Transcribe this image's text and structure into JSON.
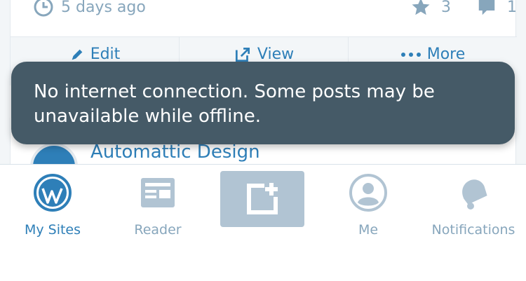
{
  "post": {
    "time_ago": "5 days ago",
    "likes": "3",
    "comments": "1",
    "actions": {
      "edit": "Edit",
      "view": "View",
      "more": "More"
    }
  },
  "next_card": {
    "site_name": "Automattic Design"
  },
  "toast": {
    "message": "No internet connection. Some posts may be unavailable while offline."
  },
  "tabbar": {
    "my_sites": "My Sites",
    "reader": "Reader",
    "me": "Me",
    "notifications": "Notifications"
  },
  "colors": {
    "accent": "#2e7fb8",
    "muted": "#87a6bc",
    "toast_bg": "#455a67",
    "write_bg": "#b1c4d3"
  }
}
